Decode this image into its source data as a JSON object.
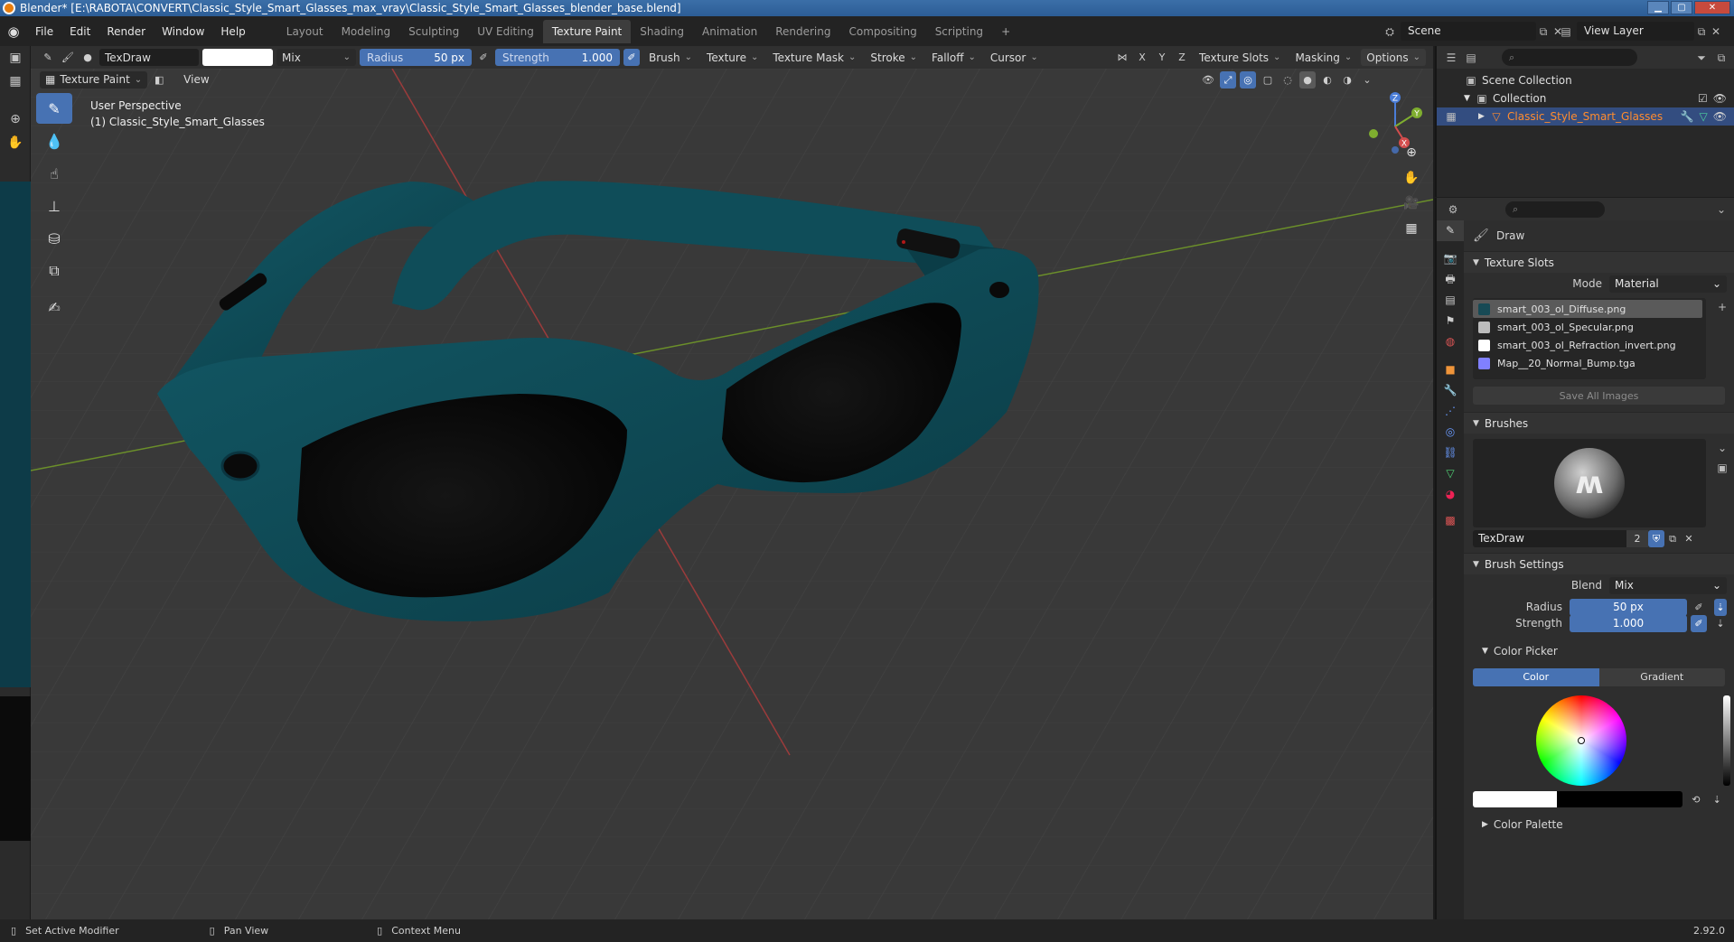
{
  "window": {
    "title": "Blender* [E:\\RABOTA\\CONVERT\\Classic_Style_Smart_Glasses_max_vray\\Classic_Style_Smart_Glasses_blender_base.blend]"
  },
  "menu": [
    "File",
    "Edit",
    "Render",
    "Window",
    "Help"
  ],
  "workspaces": [
    "Layout",
    "Modeling",
    "Sculpting",
    "UV Editing",
    "Texture Paint",
    "Shading",
    "Animation",
    "Rendering",
    "Compositing",
    "Scripting"
  ],
  "active_workspace": "Texture Paint",
  "scene": {
    "name": "Scene",
    "view_layer": "View Layer"
  },
  "tool_header": {
    "brush_name": "TexDraw",
    "blend": "Mix",
    "radius_label": "Radius",
    "radius_value": "50 px",
    "strength_label": "Strength",
    "strength_value": "1.000",
    "menus": [
      "Brush",
      "Texture",
      "Texture Mask",
      "Stroke",
      "Falloff",
      "Cursor"
    ],
    "axes": [
      "X",
      "Y",
      "Z"
    ],
    "right_menus": [
      "Texture Slots",
      "Masking",
      "Options"
    ]
  },
  "viewport_header": {
    "mode": "Texture Paint",
    "view": "View"
  },
  "viewport_info": {
    "line1": "User Perspective",
    "line2": "(1) Classic_Style_Smart_Glasses"
  },
  "gizmo": {
    "x": "X",
    "y": "Y",
    "z": "Z"
  },
  "outliner": {
    "scene_collection": "Scene Collection",
    "collection": "Collection",
    "object": "Classic_Style_Smart_Glasses"
  },
  "properties": {
    "tool_name": "Draw",
    "texture_slots": {
      "title": "Texture Slots",
      "mode_label": "Mode",
      "mode_value": "Material",
      "slots": [
        {
          "name": "smart_003_ol_Diffuse.png",
          "color": "#174a55"
        },
        {
          "name": "smart_003_ol_Specular.png",
          "color": "#bdbdbd"
        },
        {
          "name": "smart_003_ol_Refraction_invert.png",
          "color": "#ffffff"
        },
        {
          "name": "Map__20_Normal_Bump.tga",
          "color": "#8080ff"
        }
      ],
      "save_all": "Save All Images"
    },
    "brushes": {
      "title": "Brushes",
      "name": "TexDraw",
      "users": "2"
    },
    "brush_settings": {
      "title": "Brush Settings",
      "blend_label": "Blend",
      "blend_value": "Mix",
      "radius_label": "Radius",
      "radius_value": "50 px",
      "strength_label": "Strength",
      "strength_value": "1.000"
    },
    "color_picker": {
      "title": "Color Picker",
      "tab_color": "Color",
      "tab_gradient": "Gradient"
    },
    "color_palette": {
      "title": "Color Palette"
    }
  },
  "status": {
    "left": "Set Active Modifier",
    "middle": "Pan View",
    "right": "Context Menu",
    "version": "2.92.0"
  },
  "colors": {
    "accent": "#4772b3",
    "frame": "#0e4a55",
    "lens": "#0c0c0c",
    "viewport_bg": "#393939"
  }
}
